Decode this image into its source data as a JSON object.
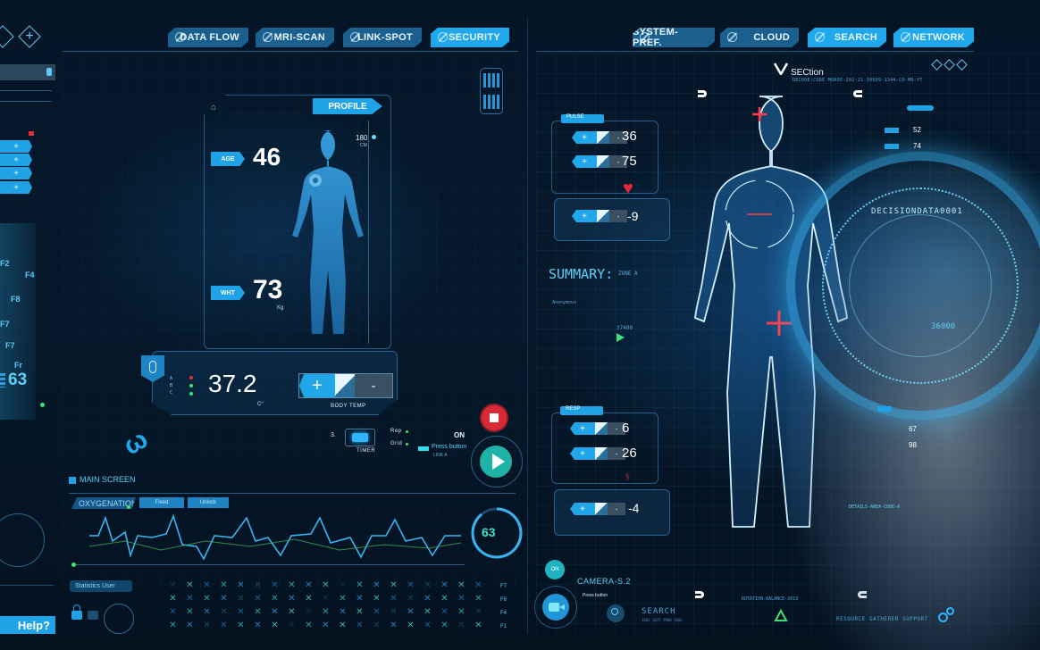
{
  "top_nav_left": [
    {
      "label": "DATA FLOW",
      "active": false
    },
    {
      "label": "MRI-SCAN",
      "active": false
    },
    {
      "label": "LINK-SPOT",
      "active": false
    },
    {
      "label": "SECURITY",
      "active": true
    }
  ],
  "top_nav_right": [
    {
      "label": "SYSTEM-PREF.",
      "active": false
    },
    {
      "label": "CLOUD",
      "active": false
    },
    {
      "label": "SEARCH",
      "active": true
    },
    {
      "label": "NETWORK",
      "active": true
    }
  ],
  "profile": {
    "title": "PROFILE",
    "age_label": "AGE",
    "age_value": "46",
    "height_value": "180",
    "height_unit": "CM",
    "weight_label": "WHT",
    "weight_value": "73",
    "weight_unit": "Kg"
  },
  "body_temp": {
    "value": "37.2",
    "unit": "C°",
    "label": "BODY TEMP",
    "rows": [
      "A",
      "B",
      "C"
    ],
    "plus": "+",
    "minus": "-"
  },
  "timer": {
    "label": "TIMER",
    "option_1": "Rep",
    "option_2": "Grid",
    "row_label": "3."
  },
  "playback": {
    "on_label": "ON",
    "press_button": "Press button",
    "sub": "LINK A"
  },
  "main_screen": {
    "title": "MAIN SCREEN",
    "oxygenation": "OXYGENATION",
    "btn_1": "Fixed",
    "btn_2": "Unlock",
    "gauge_value": "63"
  },
  "statistics": {
    "label": "Statistics User"
  },
  "help": {
    "label": "Help?"
  },
  "left_sidebar": {
    "fkeys": [
      "F2",
      "F4",
      "F8",
      "F7",
      "F7",
      "Fr"
    ],
    "counter": "63"
  },
  "dot_matrix_keys": [
    "F7",
    "F8",
    "F4",
    "F1"
  ],
  "pulse_panel": {
    "title": "PULSE",
    "values": [
      "36",
      "75",
      "-9"
    ]
  },
  "resp_panel": {
    "title": "RESP",
    "values": [
      "6",
      "26",
      "-4"
    ]
  },
  "summary": {
    "label": "SUMMARY:",
    "zone": "ZONE A",
    "sub": "Anonymous",
    "code": "37400"
  },
  "section": {
    "title": "SECtion",
    "code": "DECODE:CODE MORSE-202-21-30609-1344-CO-MR-YT"
  },
  "body_scan": {
    "caption": "ROTATION-BALANCE-2013"
  },
  "camera": {
    "on_label": "ON",
    "label": "CAMERA-S.2",
    "press_button": "Press button",
    "search": "SEARCH",
    "search_sub": "1002 1075 9900 1002"
  },
  "resource": {
    "label": "RESOURCE GATHERER SUPPORT"
  },
  "hand_overlay": {
    "values_top": [
      "52",
      "74"
    ],
    "code": "DECISIONDATA0001",
    "number": "36000",
    "values_bottom": [
      "67",
      "98"
    ],
    "details": "DETAILS-AREA-CODE-A"
  },
  "colors": {
    "accent": "#1fa8ec",
    "alert": "#e0303a",
    "ok": "#3fe07a",
    "teal": "#1fb3a8"
  }
}
